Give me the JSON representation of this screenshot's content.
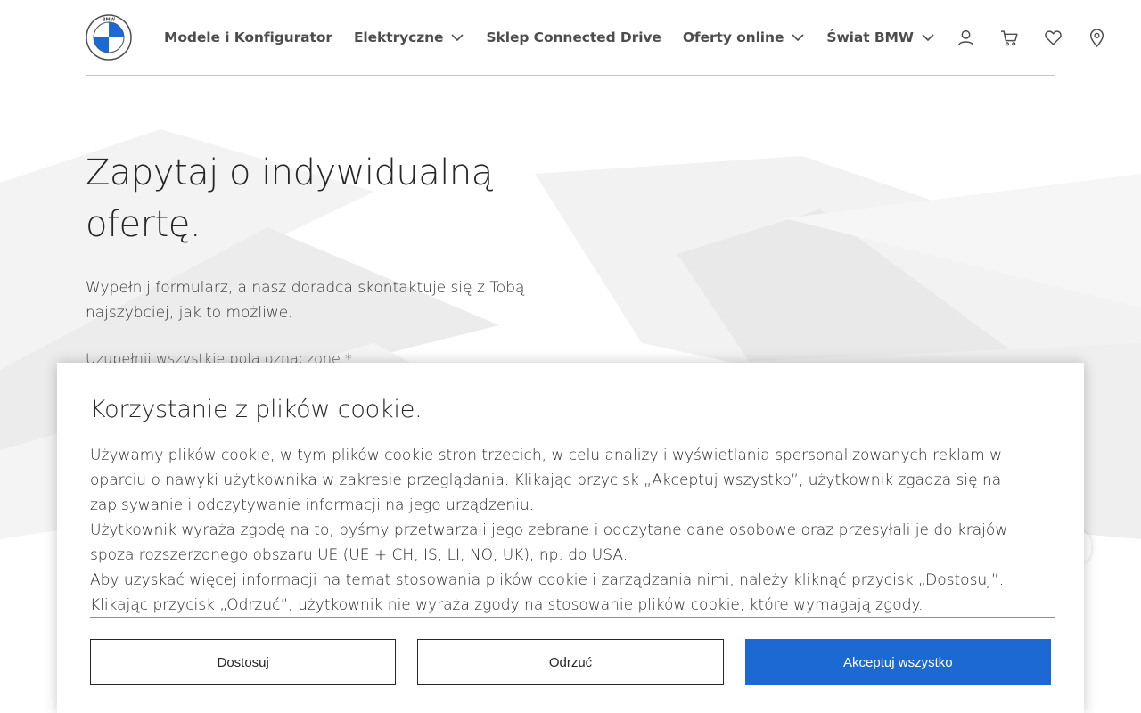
{
  "header": {
    "logo_alt": "BMW",
    "nav": [
      {
        "label": "Modele i Konfigurator",
        "has_dropdown": false
      },
      {
        "label": "Elektryczne",
        "has_dropdown": true
      },
      {
        "label": "Sklep Connected Drive",
        "has_dropdown": false
      },
      {
        "label": "Oferty online",
        "has_dropdown": true
      },
      {
        "label": "Świat BMW",
        "has_dropdown": true
      }
    ],
    "utility_icons": [
      "user-icon",
      "cart-icon",
      "heart-icon",
      "location-pin-icon"
    ]
  },
  "hero": {
    "title_line1": "Zapytaj o indywidualną",
    "title_line2": "ofertę.",
    "lead": "Wypełnij formularz, a nasz doradca skontaktuje się z Tobą najszybciej, jak to możliwe.",
    "required_note": "Uzupełnij wszystkie pola oznaczone *"
  },
  "cookie_banner": {
    "title": "Korzystanie z plików cookie.",
    "paragraphs": [
      "Używamy plików cookie, w tym plików cookie stron trzecich, w celu analizy i wyświetlania spersonalizowanych reklam w oparciu o nawyki użytkownika w zakresie przeglądania. Klikając przycisk „Akceptuj wszystko”, użytkownik zgadza się na zapisywanie i odczytywanie informacji na jego urządzeniu.",
      "Użytkownik wyraża zgodę na to, byśmy przetwarzali jego zebrane i odczytane dane osobowe oraz przesyłali je do krajów spoza rozszerzonego obszaru UE (UE + CH, IS, LI, NO, UK), np. do USA.",
      "Aby uzyskać więcej informacji na temat stosowania plików cookie i zarządzania nimi, należy kliknąć przycisk „Dostosuj”. Klikając przycisk „Odrzuć”, użytkownik nie wyraża zgody na stosowanie plików cookie, które wymagają zgody."
    ],
    "buttons": {
      "customize": "Dostosuj",
      "reject": "Odrzuć",
      "accept_all": "Akceptuj wszystko"
    }
  },
  "colors": {
    "primary_blue": "#1c69d4",
    "text": "#262626",
    "nav_text": "#4d4d4d",
    "divider": "#c6c6c6"
  }
}
